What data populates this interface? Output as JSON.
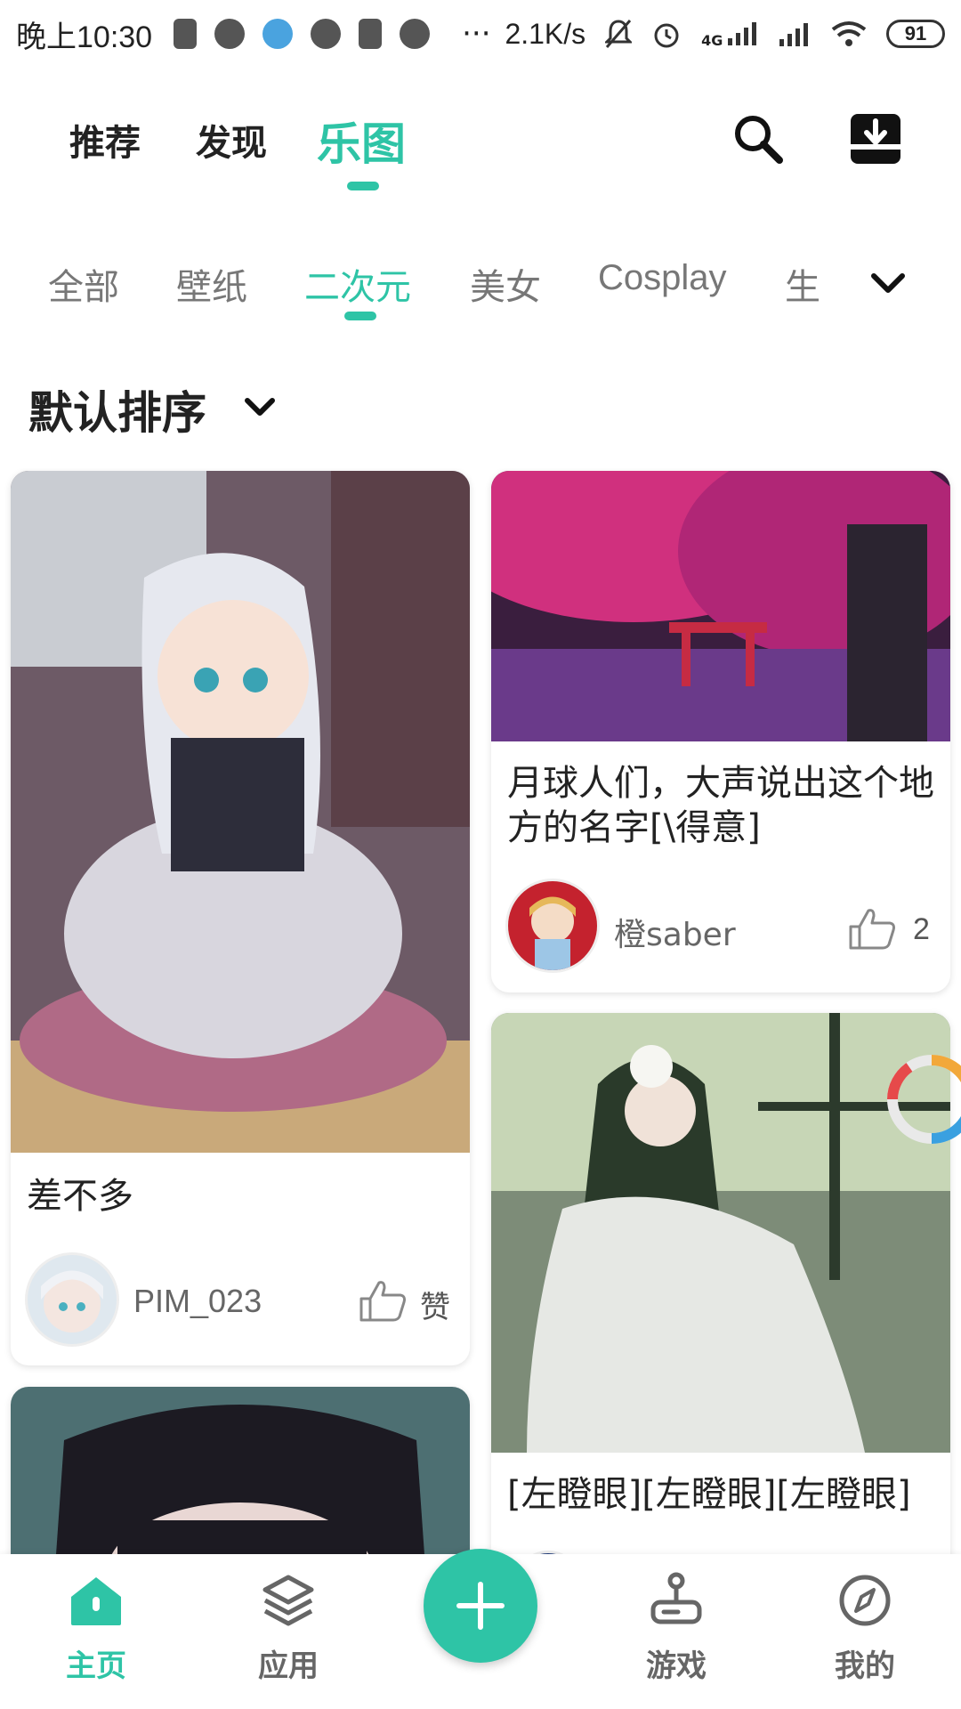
{
  "status_bar": {
    "time": "晚上10:30",
    "network_speed": "2.1K/s",
    "signal_label": "4G",
    "battery": "91"
  },
  "header": {
    "tabs": [
      {
        "label": "推荐"
      },
      {
        "label": "发现"
      },
      {
        "label": "乐图",
        "active": true
      }
    ]
  },
  "categories": {
    "items": [
      "全部",
      "壁纸",
      "二次元",
      "美女",
      "Cosplay",
      "生"
    ],
    "active": "二次元"
  },
  "sort": {
    "label": "默认排序"
  },
  "feed": {
    "cards": [
      {
        "title": "差不多",
        "user": "PIM_023",
        "likes": "赞"
      },
      {
        "title": "月球人们，大声说出这个地方的名字[\\得意]",
        "user": "橙saber",
        "likes": "2"
      },
      {
        "title": "[左瞪眼][左瞪眼][左瞪眼]"
      }
    ]
  },
  "bottom_nav": {
    "items": [
      {
        "label": "主页",
        "icon": "home-icon",
        "active": true
      },
      {
        "label": "应用",
        "icon": "layers-icon"
      },
      {
        "label": "游戏",
        "icon": "joystick-icon"
      },
      {
        "label": "我的",
        "icon": "compass-icon"
      }
    ],
    "fab_icon": "plus-icon"
  },
  "colors": {
    "accent": "#2ec4a6"
  }
}
